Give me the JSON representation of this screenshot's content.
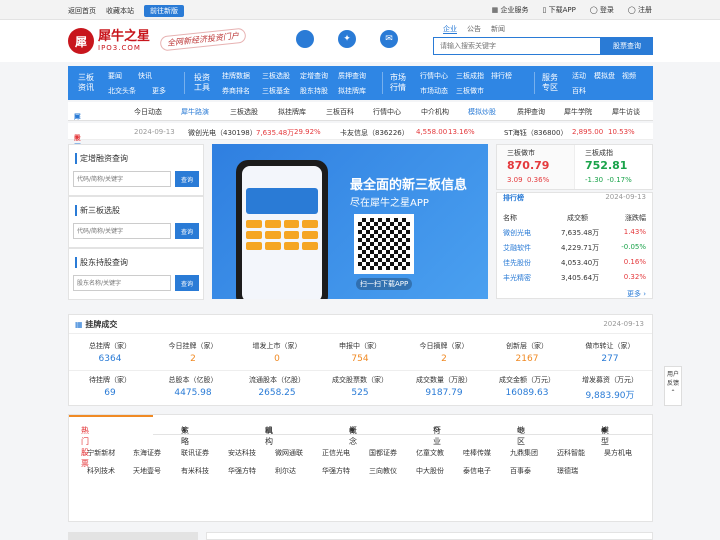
{
  "topbar": {
    "home": "返回首页",
    "fav": "收藏本站",
    "new_btn": "前往新版",
    "enterprise": "企业服务",
    "download": "下载APP",
    "login": "登录",
    "register": "注册"
  },
  "logo": {
    "icon": "犀",
    "title": "犀牛之星",
    "domain": "IPO3.COM",
    "slogan": "全网新经济投资门户"
  },
  "search": {
    "tabs": [
      "企业",
      "公告",
      "新闻"
    ],
    "placeholder": "请输入搜索关键字",
    "button": "股票查询"
  },
  "nav": {
    "g1": {
      "title": "三板资讯",
      "items": [
        "要闻",
        "快讯",
        "北交头条",
        "更多"
      ]
    },
    "g2": {
      "title": "投资工具",
      "items": [
        "挂牌数据",
        "三板选股",
        "定增查询",
        "质押查询",
        "券商排名",
        "三板基金",
        "股东持股",
        "拟挂牌库"
      ]
    },
    "g3": {
      "title": "市场行情",
      "items": [
        "行情中心",
        "三板成指",
        "排行榜",
        "市场动态",
        "三板做市"
      ]
    },
    "g4": {
      "title": "服务专区",
      "items": [
        "活动",
        "模拟盘",
        "视频",
        "百科"
      ]
    }
  },
  "subnav": [
    "犀牛首页",
    "今日动态",
    "犀牛路演",
    "三板选股",
    "拟挂牌库",
    "三板百科",
    "行情中心",
    "中介机构",
    "模拟炒股",
    "质押查询",
    "犀牛学院",
    "犀牛访谈"
  ],
  "ticker": {
    "label": "股票异动",
    "date": "2024-09-13",
    "s1_name": "微创光电（430198）",
    "s1_price": "7,635.48万",
    "s1_pct": "29.92%",
    "s2_name": "卡友信息（836226）",
    "s2_price": "4,558.00",
    "s2_pct": "13.16%",
    "s3_name": "ST海钰（836800）",
    "s3_price": "2,895.00",
    "s3_pct": "10.53%"
  },
  "query": [
    {
      "title": "定增融资查询",
      "placeholder": "代码/简称/关键字",
      "button": "查询"
    },
    {
      "title": "新三板选股",
      "placeholder": "代码/简称/关键字",
      "button": "查询"
    },
    {
      "title": "股东持股查询",
      "placeholder": "股东名称/关键字",
      "button": "查询"
    }
  ],
  "banner": {
    "line1": "最全面的新三板信息",
    "line2": "尽在犀牛之星APP",
    "download": "扫一扫下载APP"
  },
  "index": {
    "a_name": "三板做市",
    "a_val": "870.79",
    "a_chg": "3.09",
    "a_pct": "0.36%",
    "b_name": "三板成指",
    "b_val": "752.81",
    "b_chg": "-1.30",
    "b_pct": "-0.17%"
  },
  "rank": {
    "title": "排行榜",
    "date": "2024-09-13",
    "headers": [
      "名称",
      "成交额",
      "涨跌幅"
    ],
    "rows": [
      [
        "微创光电",
        "7,635.48万",
        "1.43%"
      ],
      [
        "艾融软件",
        "4,229.71万",
        "-0.05%"
      ],
      [
        "佳先股份",
        "4,053.40万",
        "0.16%"
      ],
      [
        "丰光精密",
        "3,405.64万",
        "0.32%"
      ]
    ],
    "more": "更多"
  },
  "stats": {
    "title": "挂牌成交",
    "date": "2024-09-13",
    "cells": [
      [
        "总挂牌（家）",
        "6364"
      ],
      [
        "今日挂牌（家）",
        "2"
      ],
      [
        "增发上市（家）",
        "0"
      ],
      [
        "申报中（家）",
        "754"
      ],
      [
        "今日摘牌（家）",
        "2"
      ],
      [
        "创新层（家）",
        "2167"
      ],
      [
        "做市转让（家）",
        "277"
      ],
      [
        "待挂牌（家）",
        "69"
      ],
      [
        "总股本（亿股）",
        "4475.98"
      ],
      [
        "流通股本（亿股）",
        "2658.25"
      ],
      [
        "成交股票数（家）",
        "525"
      ],
      [
        "成交数量（万股）",
        "9187.79"
      ],
      [
        "成交金额（万元）",
        "16089.63"
      ],
      [
        "增发募资（万元）",
        "9,883.90万"
      ]
    ]
  },
  "hot": {
    "tabs": [
      "热门股票",
      "策略",
      "机构",
      "概念",
      "行业",
      "地区",
      "模型"
    ],
    "row1": [
      "宁新新材",
      "东海证券",
      "联讯证券",
      "安达科技",
      "微网通联",
      "正信光电",
      "国都证券",
      "亿童文教",
      "哇棒传媒",
      "九鼎集团",
      "迈科智能",
      "昊方机电"
    ],
    "row2": [
      "科列技术",
      "天地壹号",
      "有米科技",
      "华强方特",
      "利尔达",
      "华强方特",
      "三向教仪",
      "中大股份",
      "泰信电子",
      "百事泰",
      "璟德瑞"
    ]
  },
  "feedback": "用户反馈",
  "colors": {
    "accent": "#2a7bd6",
    "nav": "#2f86e4",
    "up": "#e4393c",
    "down": "#1aa34a"
  }
}
